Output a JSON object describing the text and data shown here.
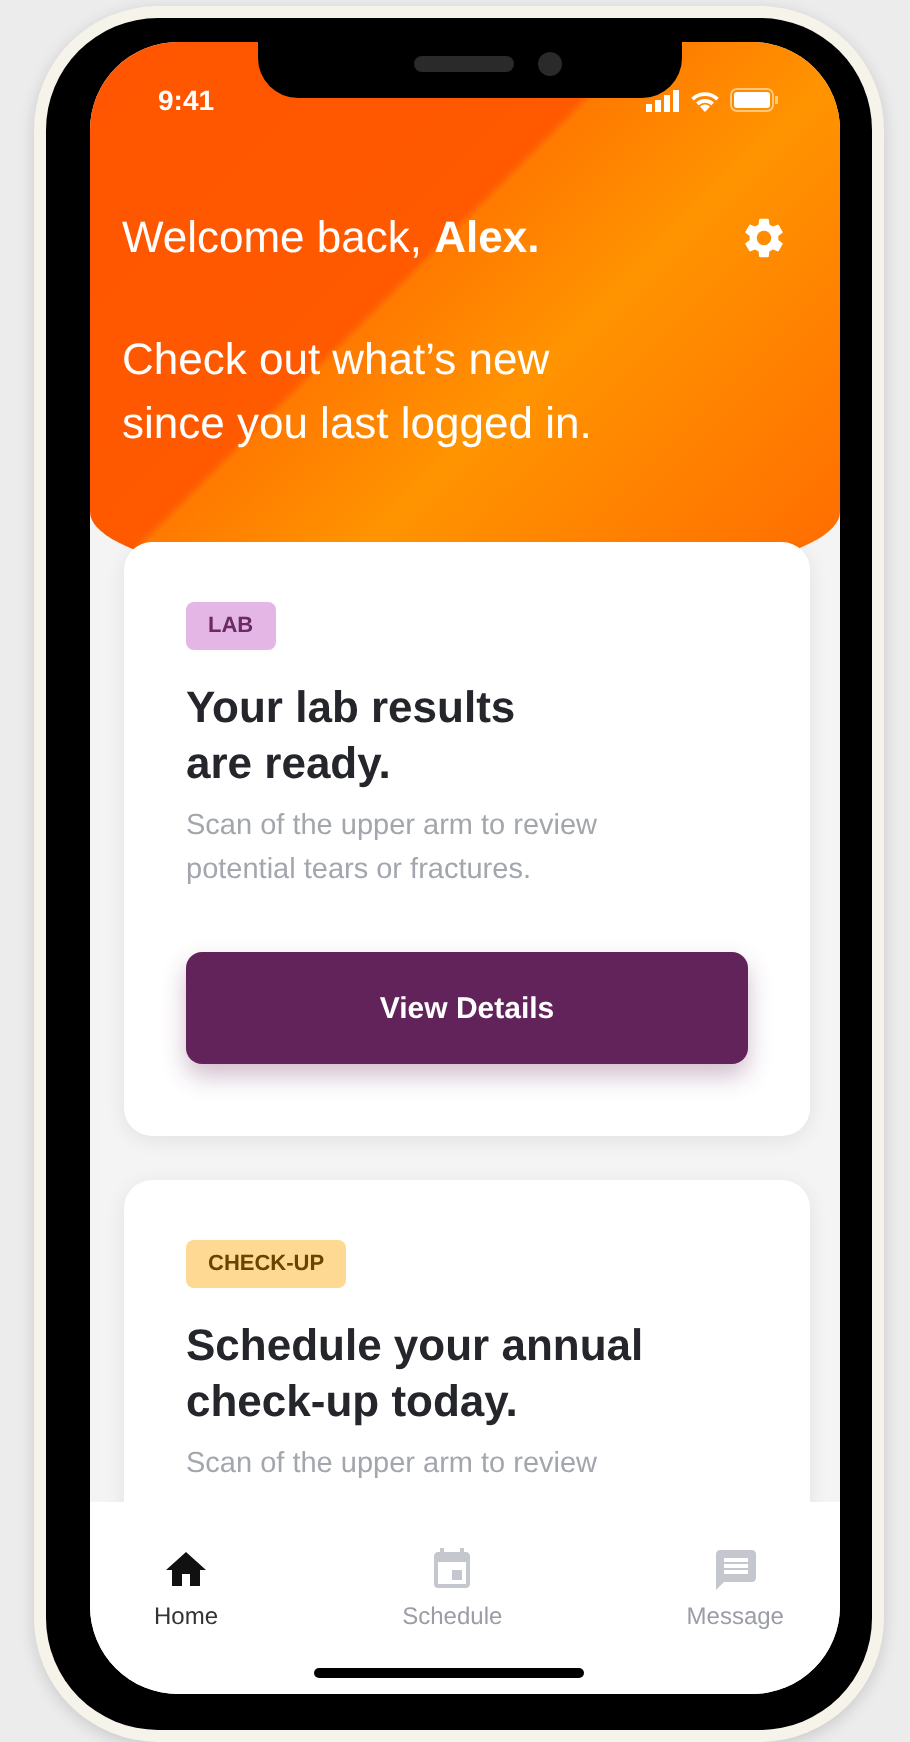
{
  "status_bar": {
    "time": "9:41"
  },
  "header": {
    "greeting": "Welcome back, **Alex.**",
    "subtitle": "Check out what’s new since you last logged in."
  },
  "cards": [
    {
      "kind": "lab",
      "tag": "LAB",
      "color": "#e3b6e6",
      "title": "Your lab results are ready.",
      "description": "Scan of the upper arm to review potential tears or fractures.",
      "button": "View Details"
    },
    {
      "kind": "checkup",
      "tag": "CHECK-UP",
      "color": "#fdd993",
      "title": "Schedule your annual check-up today.",
      "description": "Scan of the upper arm to review"
    }
  ],
  "tabs": [
    {
      "kind": "home",
      "label": "Home",
      "selected": true
    },
    {
      "kind": "schedule",
      "label": "Schedule",
      "selected": false
    },
    {
      "kind": "message",
      "label": "Message",
      "selected": false
    }
  ]
}
